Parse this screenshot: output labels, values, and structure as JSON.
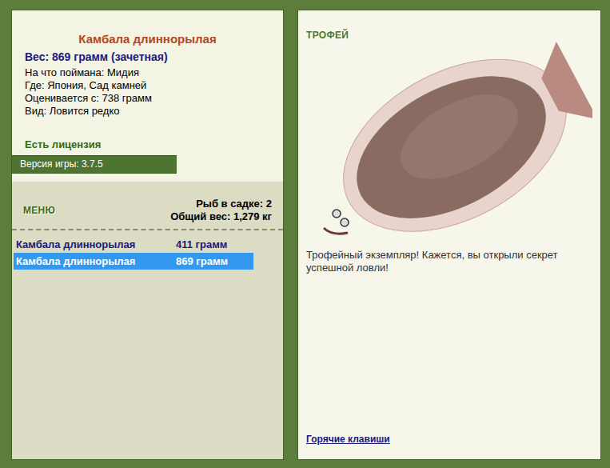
{
  "fish_card": {
    "title": "Камбала длиннорылая",
    "weight": "Вес: 869 грамм (зачетная)",
    "details": [
      "На что поймана: Мидия",
      "Где: Япония, Сад камней",
      "Оценивается с: 738 грамм",
      "Вид: Ловится редко"
    ],
    "license": "Есть лицензия",
    "version": "Версия игры: 3.7.5"
  },
  "menu": {
    "label": "МЕНЮ",
    "keepnet_count": "Рыб в садке: 2",
    "total_weight": "Общий вес: 1,279 кг"
  },
  "catch_list": [
    {
      "name": "Камбала длиннорылая",
      "weight": "411 грамм",
      "selected": false
    },
    {
      "name": "Камбала длиннорылая",
      "weight": "869 грамм",
      "selected": true
    }
  ],
  "trophy": {
    "label": "ТРОФЕЙ",
    "message": "Трофейный экземпляр! Кажется, вы открыли секрет успешной ловли!",
    "hotkeys_link": "Горячие клавиши"
  }
}
